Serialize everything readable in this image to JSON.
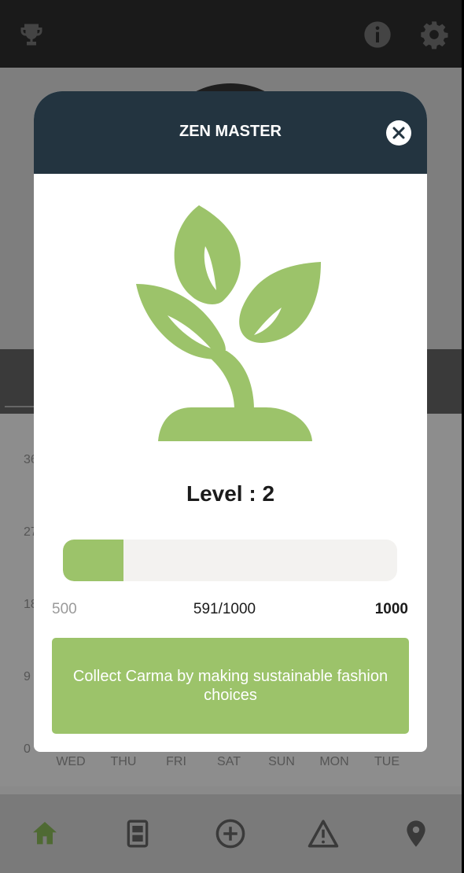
{
  "dialog": {
    "title": "ZEN MASTER",
    "level_text": "Level : 2",
    "progress": {
      "min_label": "500",
      "current_label": "591/1000",
      "max_label": "1000",
      "fill_fraction": 0.18
    },
    "message": "Collect Carma by making sustainable fashion choices"
  },
  "background": {
    "y_labels": [
      "36",
      "27",
      "18",
      "9",
      "0"
    ],
    "days": [
      "WED",
      "THU",
      "FRI",
      "SAT",
      "SUN",
      "MON",
      "TUE"
    ]
  },
  "icons": {
    "top_left": "trophy-icon",
    "top_right": [
      "info-icon",
      "gear-icon"
    ],
    "bottom_nav": [
      "home-icon",
      "wardrobe-icon",
      "add-circle-icon",
      "warning-icon",
      "location-icon"
    ]
  },
  "colors": {
    "accent_green": "#9cc36a",
    "dialog_header": "#233440"
  }
}
